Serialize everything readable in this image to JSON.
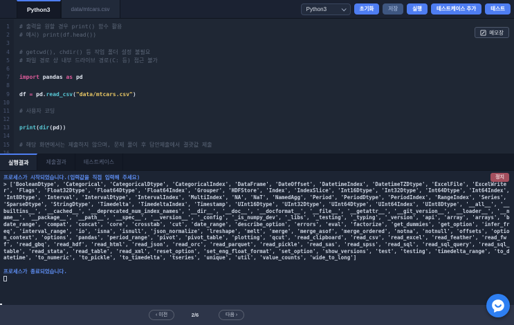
{
  "topbar": {
    "tabs": [
      {
        "id": "python3",
        "label": "Python3",
        "active": true
      },
      {
        "id": "mtcars-csv",
        "label": "data/mtcars.csv",
        "active": false
      }
    ],
    "language_select": {
      "value": "Python3"
    },
    "buttons": {
      "reset": "초기화",
      "save": "저장",
      "run": "실행",
      "add_testcase": "테스트케이스 추가",
      "test": "테스트"
    }
  },
  "editor": {
    "memo_button_label": "메모장",
    "lines": [
      [
        [
          "c",
          "# 출력을 원할 경우 print() 함수 활용"
        ]
      ],
      [
        [
          "c",
          "# 예시) print(df.head())"
        ]
      ],
      [],
      [
        [
          "c",
          "# getcwd(), chdir() 등 작업 폴더 설정 불필요"
        ]
      ],
      [
        [
          "c",
          "# 파일 경로 상 내부 드라이브 경로(C: 등) 접근 불가"
        ]
      ],
      [],
      [
        [
          "k",
          "import"
        ],
        [
          "p",
          " "
        ],
        [
          "i",
          "pandas"
        ],
        [
          "p",
          " "
        ],
        [
          "k",
          "as"
        ],
        [
          "p",
          " "
        ],
        [
          "i",
          "pd"
        ]
      ],
      [],
      [
        [
          "i",
          "df"
        ],
        [
          "p",
          " "
        ],
        [
          "k",
          "="
        ],
        [
          "p",
          " "
        ],
        [
          "i",
          "pd"
        ],
        [
          "p",
          "."
        ],
        [
          "f",
          "read_csv"
        ],
        [
          "p",
          "("
        ],
        [
          "s",
          "\"data/mtcars.csv\""
        ],
        [
          "p",
          ")"
        ]
      ],
      [],
      [
        [
          "c",
          "# 사용자 코딩"
        ]
      ],
      [],
      [
        [
          "f",
          "print"
        ],
        [
          "p",
          "("
        ],
        [
          "f",
          "dir"
        ],
        [
          "p",
          "("
        ],
        [
          "i",
          "pd"
        ],
        [
          "p",
          "))"
        ]
      ],
      [],
      [
        [
          "c",
          "# 해당 화면에서는 제출하지 않으며, 문제 풀이 후 답안제출에서 결괏값 제출"
        ]
      ],
      []
    ]
  },
  "panel": {
    "tabs": [
      {
        "id": "run-result",
        "label": "실행결과",
        "active": true
      },
      {
        "id": "submit-result",
        "label": "제출결과",
        "active": false
      },
      {
        "id": "testcase",
        "label": "테스트케이스",
        "active": false
      }
    ],
    "stop_button_label": "정지"
  },
  "console": {
    "started_message": "프로세스가 시작되었습니다.(입력값을 직접 입력해 주세요)",
    "output": "> ['BooleanDtype', 'Categorical', 'CategoricalDtype', 'CategoricalIndex', 'DataFrame', 'DateOffset', 'DatetimeIndex', 'DatetimeTZDtype', 'ExcelFile', 'ExcelWriter', 'Flags', 'Float32Dtype', 'Float64Dtype', 'Float64Index', 'Grouper', 'HDFStore', 'Index', 'IndexSlice', 'Int16Dtype', 'Int32Dtype', 'Int64Dtype', 'Int64Index', 'Int8Dtype', 'Interval', 'IntervalDtype', 'IntervalIndex', 'MultiIndex', 'NA', 'NaT', 'NamedAgg', 'Period', 'PeriodDtype', 'PeriodIndex', 'RangeIndex', 'Series', 'SparseDtype', 'StringDtype', 'Timedelta', 'TimedeltaIndex', 'Timestamp', 'UInt16Dtype', 'UInt32Dtype', 'UInt64Dtype', 'UInt64Index', 'UInt8Dtype', '__all__', '__builtins__', '__cached__', '__deprecated_num_index_names', '__dir__', '__doc__', '__docformat__', '__file__', '__getattr__', '__git_version__', '__loader__', '__name__', '__package__', '__path__', '__spec__', '__version__', '_config', '_is_numpy_dev', '_libs', '_testing', '_typing', '_version', 'api', 'array', 'arrays', 'bdate_range', 'compat', 'concat', 'core', 'crosstab', 'cut', 'date_range', 'describe_option', 'errors', 'eval', 'factorize', 'get_dummies', 'get_option', 'infer_freq', 'interval_range', 'io', 'isna', 'isnull', 'json_normalize', 'lreshape', 'melt', 'merge', 'merge_asof', 'merge_ordered', 'notna', 'notnull', 'offsets', 'option_context', 'options', 'pandas', 'period_range', 'pivot', 'pivot_table', 'plotting', 'qcut', 'read_clipboard', 'read_csv', 'read_excel', 'read_feather', 'read_fwf', 'read_gbq', 'read_hdf', 'read_html', 'read_json', 'read_orc', 'read_parquet', 'read_pickle', 'read_sas', 'read_spss', 'read_sql', 'read_sql_query', 'read_sql_table', 'read_stata', 'read_table', 'read_xml', 'reset_option', 'set_eng_float_format', 'set_option', 'show_versions', 'test', 'testing', 'timedelta_range', 'to_datetime', 'to_numeric', 'to_pickle', 'to_timedelta', 'tseries', 'unique', 'util', 'value_counts', 'wide_to_long']",
    "finished_message": "프로세스가 종료되었습니다."
  },
  "pagination": {
    "prev_label": "‹ 이전",
    "current": "2/6",
    "next_label": "다음 ›"
  },
  "colors": {
    "accent_blue": "#4e7df2",
    "stop_red": "#a44f5e",
    "console_info_blue": "#5d8cf0",
    "editor_bg": "#1f2734",
    "console_bg": "#1c2433"
  }
}
